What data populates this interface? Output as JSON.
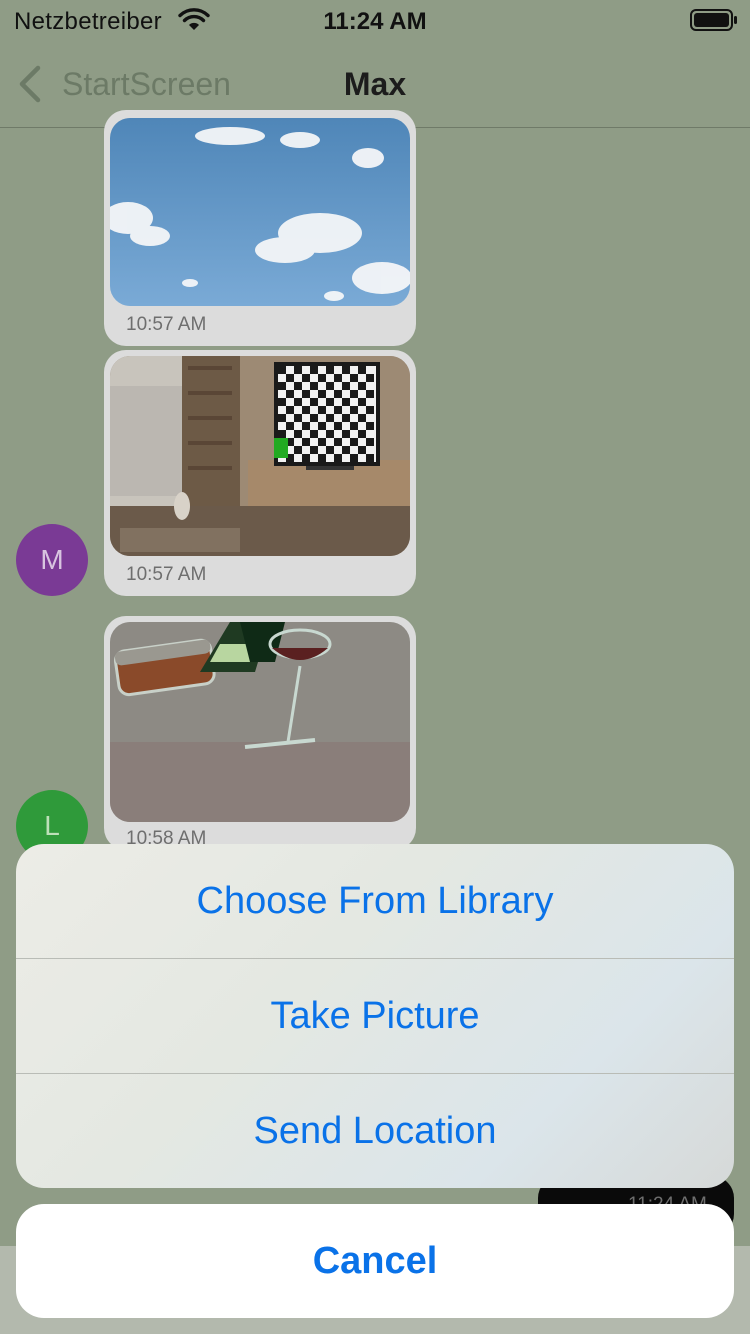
{
  "status_bar": {
    "carrier": "Netzbetreiber",
    "time": "11:24 AM",
    "wifi_icon": "wifi-icon",
    "battery_icon": "battery-icon"
  },
  "nav_bar": {
    "back_label": "StartScreen",
    "title": "Max",
    "back_icon": "chevron-left-icon"
  },
  "messages": [
    {
      "type": "image",
      "content": "sky with clouds",
      "time": "10:57 AM"
    },
    {
      "type": "image",
      "content": "room with checkerboard TV and cat",
      "time": "10:57 AM",
      "avatar": "M",
      "avatar_color": "#7a3a95"
    },
    {
      "type": "image",
      "content": "drawing of bottles and wine glass",
      "time": "10:58 AM",
      "avatar": "L",
      "avatar_color": "#2f9a3a"
    },
    {
      "type": "text",
      "time": "11:24 AM"
    }
  ],
  "action_sheet": {
    "options": [
      "Choose From Library",
      "Take Picture",
      "Send Location"
    ],
    "cancel": "Cancel"
  },
  "colors": {
    "accent": "#0a72e8",
    "dim_background": "#8f9c86"
  }
}
